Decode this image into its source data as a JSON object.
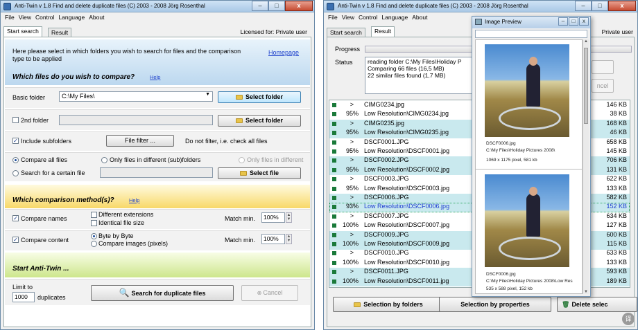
{
  "app": {
    "title": "Anti-Twin",
    "title_bar": "Anti-Twin   v 1.8    Find and delete duplicate files   (C) 2003 - 2008  Jörg Rosenthal",
    "menu": [
      "File",
      "View",
      "Control",
      "Language",
      "About"
    ],
    "window_buttons": {
      "min": "–",
      "max": "□",
      "close": "x"
    }
  },
  "left": {
    "tabs": [
      "Start search",
      "Result"
    ],
    "licensed": "Licensed for: Private user",
    "intro": "Here please select in which folders you wish to search for files and the comparison type to be applied",
    "homepage": "Homepage",
    "section1": {
      "title": "Which files do you wish to compare?",
      "help": "Help"
    },
    "basic_folder": {
      "label": "Basic folder",
      "value": "C:\\My Files\\",
      "button": "Select folder"
    },
    "second_folder": {
      "label": "2nd folder",
      "value": "",
      "button": "Select folder",
      "checked": false
    },
    "subfolders": {
      "label": "Include subfolders",
      "checked": true
    },
    "file_filter": {
      "button": "File filter ...",
      "text": "Do not filter, i.e. check all files"
    },
    "compare_all": {
      "label": "Compare all files",
      "selected": true
    },
    "only_diff_sub": {
      "label": "Only files in different (sub)folders",
      "selected": false
    },
    "only_diff": {
      "label": "Only files in different",
      "selected": false
    },
    "search_file": {
      "label": "Search for a certain file",
      "button": "Select file",
      "selected": false
    },
    "section2": {
      "title": "Which comparison method(s)?",
      "help": "Help"
    },
    "compare_names": {
      "label": "Compare names",
      "checked": true
    },
    "diff_ext": {
      "label": "Different extensions",
      "checked": false
    },
    "ident_size": {
      "label": "Identical file size",
      "checked": false
    },
    "match_names": {
      "label": "Match min.",
      "value": "100%"
    },
    "compare_content": {
      "label": "Compare content",
      "checked": true
    },
    "byte_by_byte": {
      "label": "Byte by Byte",
      "selected": true
    },
    "compare_images": {
      "label": "Compare images (pixels)",
      "selected": false
    },
    "match_content": {
      "label": "Match min.",
      "value": "100%"
    },
    "section3": {
      "title": "Start Anti-Twin ..."
    },
    "limit": {
      "label": "Limit to",
      "value": "1000",
      "suffix": "duplicates"
    },
    "search_button": "Search for duplicate files",
    "cancel_button": "Cancel"
  },
  "right": {
    "tabs": [
      "Start search",
      "Result"
    ],
    "licensed": "Private user",
    "progress_label": "Progress",
    "status_label": "Status",
    "status_lines": [
      "reading folder C:\\My Files\\Holiday P",
      "Comparing 66 files (16,5 MB)",
      "22 similar files found (1,7 MB)"
    ],
    "cancel_hidden": "ncel",
    "rows": [
      {
        "marker": true,
        "percent": ">",
        "name": "CIMG0234.jpg",
        "size": "146 KB",
        "hl": false
      },
      {
        "marker": true,
        "percent": "95%",
        "name": "Low Resolution\\CIMG0234.jpg",
        "size": "38 KB",
        "hl": false
      },
      {
        "marker": true,
        "percent": ">",
        "name": "CIMG0235.jpg",
        "size": "168 KB",
        "hl": true
      },
      {
        "marker": true,
        "percent": "95%",
        "name": "Low Resolution\\CIMG0235.jpg",
        "size": "46 KB",
        "hl": true
      },
      {
        "marker": true,
        "percent": ">",
        "name": "DSCF0001.JPG",
        "size": "658 KB",
        "hl": false
      },
      {
        "marker": true,
        "percent": "95%",
        "name": "Low Resolution\\DSCF0001.jpg",
        "size": "145 KB",
        "hl": false
      },
      {
        "marker": true,
        "percent": ">",
        "name": "DSCF0002.JPG",
        "size": "706 KB",
        "hl": true
      },
      {
        "marker": true,
        "percent": "95%",
        "name": "Low Resolution\\DSCF0002.jpg",
        "size": "131 KB",
        "hl": true
      },
      {
        "marker": true,
        "percent": ">",
        "name": "DSCF0003.JPG",
        "size": "622 KB",
        "hl": false
      },
      {
        "marker": true,
        "percent": "95%",
        "name": "Low Resolution\\DSCF0003.jpg",
        "size": "133 KB",
        "hl": false
      },
      {
        "marker": true,
        "percent": ">",
        "name": "DSCF0006.JPG",
        "size": "582 KB",
        "hl": true
      },
      {
        "marker": true,
        "percent": "93%",
        "name": "Low Resolution\\DSCF0006.jpg",
        "size": "152 KB",
        "hl": true,
        "selected": true
      },
      {
        "marker": true,
        "percent": ">",
        "name": "DSCF0007.JPG",
        "size": "634 KB",
        "hl": false
      },
      {
        "marker": true,
        "percent": "100%",
        "name": "Low Resolution\\DSCF0007.jpg",
        "size": "127 KB",
        "hl": false
      },
      {
        "marker": true,
        "percent": ">",
        "name": "DSCF0009.JPG",
        "size": "600 KB",
        "hl": true
      },
      {
        "marker": true,
        "percent": "100%",
        "name": "Low Resolution\\DSCF0009.jpg",
        "size": "115 KB",
        "hl": true
      },
      {
        "marker": true,
        "percent": ">",
        "name": "DSCF0010.JPG",
        "size": "633 KB",
        "hl": false
      },
      {
        "marker": true,
        "percent": "100%",
        "name": "Low Resolution\\DSCF0010.jpg",
        "size": "133 KB",
        "hl": false
      },
      {
        "marker": true,
        "percent": ">",
        "name": "DSCF0011.JPG",
        "size": "593 KB",
        "hl": true
      },
      {
        "marker": true,
        "percent": "100%",
        "name": "Low Resolution\\DSCF0011.jpg",
        "size": "189 KB",
        "hl": true
      }
    ],
    "btn_folders": "Selection by folders",
    "btn_properties": "Selection by properties",
    "btn_delete": "Delete selec"
  },
  "preview": {
    "title": "Image Preview",
    "img1": {
      "name": "DSCF0006.jpg",
      "path": "C:\\My Files\\Holiday Pictures 2008\\",
      "info": "1069 x 1175 pixel, 581 kb"
    },
    "img2": {
      "name": "DSCF0006.jpg",
      "path": "C:\\My Files\\Holiday Pictures 2008\\Low Res",
      "info": "535 x 588 pixel, 152 kb"
    }
  },
  "colors": {
    "highlight_row": "#c9e9ee",
    "marker": "#1a7a3a",
    "link": "#2244cc",
    "selected_text": "#1a3ad0"
  }
}
